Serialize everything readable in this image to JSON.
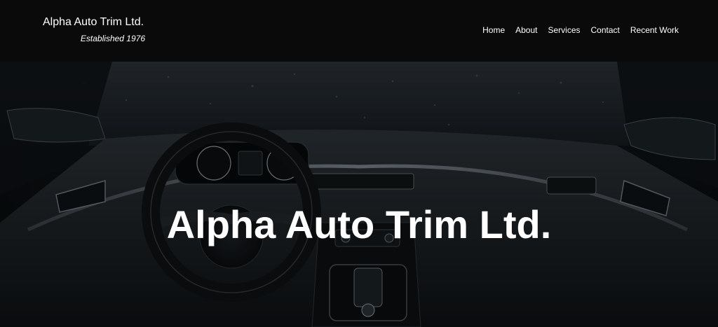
{
  "header": {
    "brand_name": "Alpha Auto Trim Ltd.",
    "tagline": "Established 1976",
    "background_color": "#0a0a0a"
  },
  "nav": {
    "items": [
      {
        "label": "Home"
      },
      {
        "label": "About"
      },
      {
        "label": "Services"
      },
      {
        "label": "Contact"
      },
      {
        "label": "Recent Work"
      }
    ]
  },
  "hero": {
    "title": "Alpha Auto Trim Ltd.",
    "image_subject": "car-dashboard-interior",
    "text_color": "#ffffff"
  }
}
